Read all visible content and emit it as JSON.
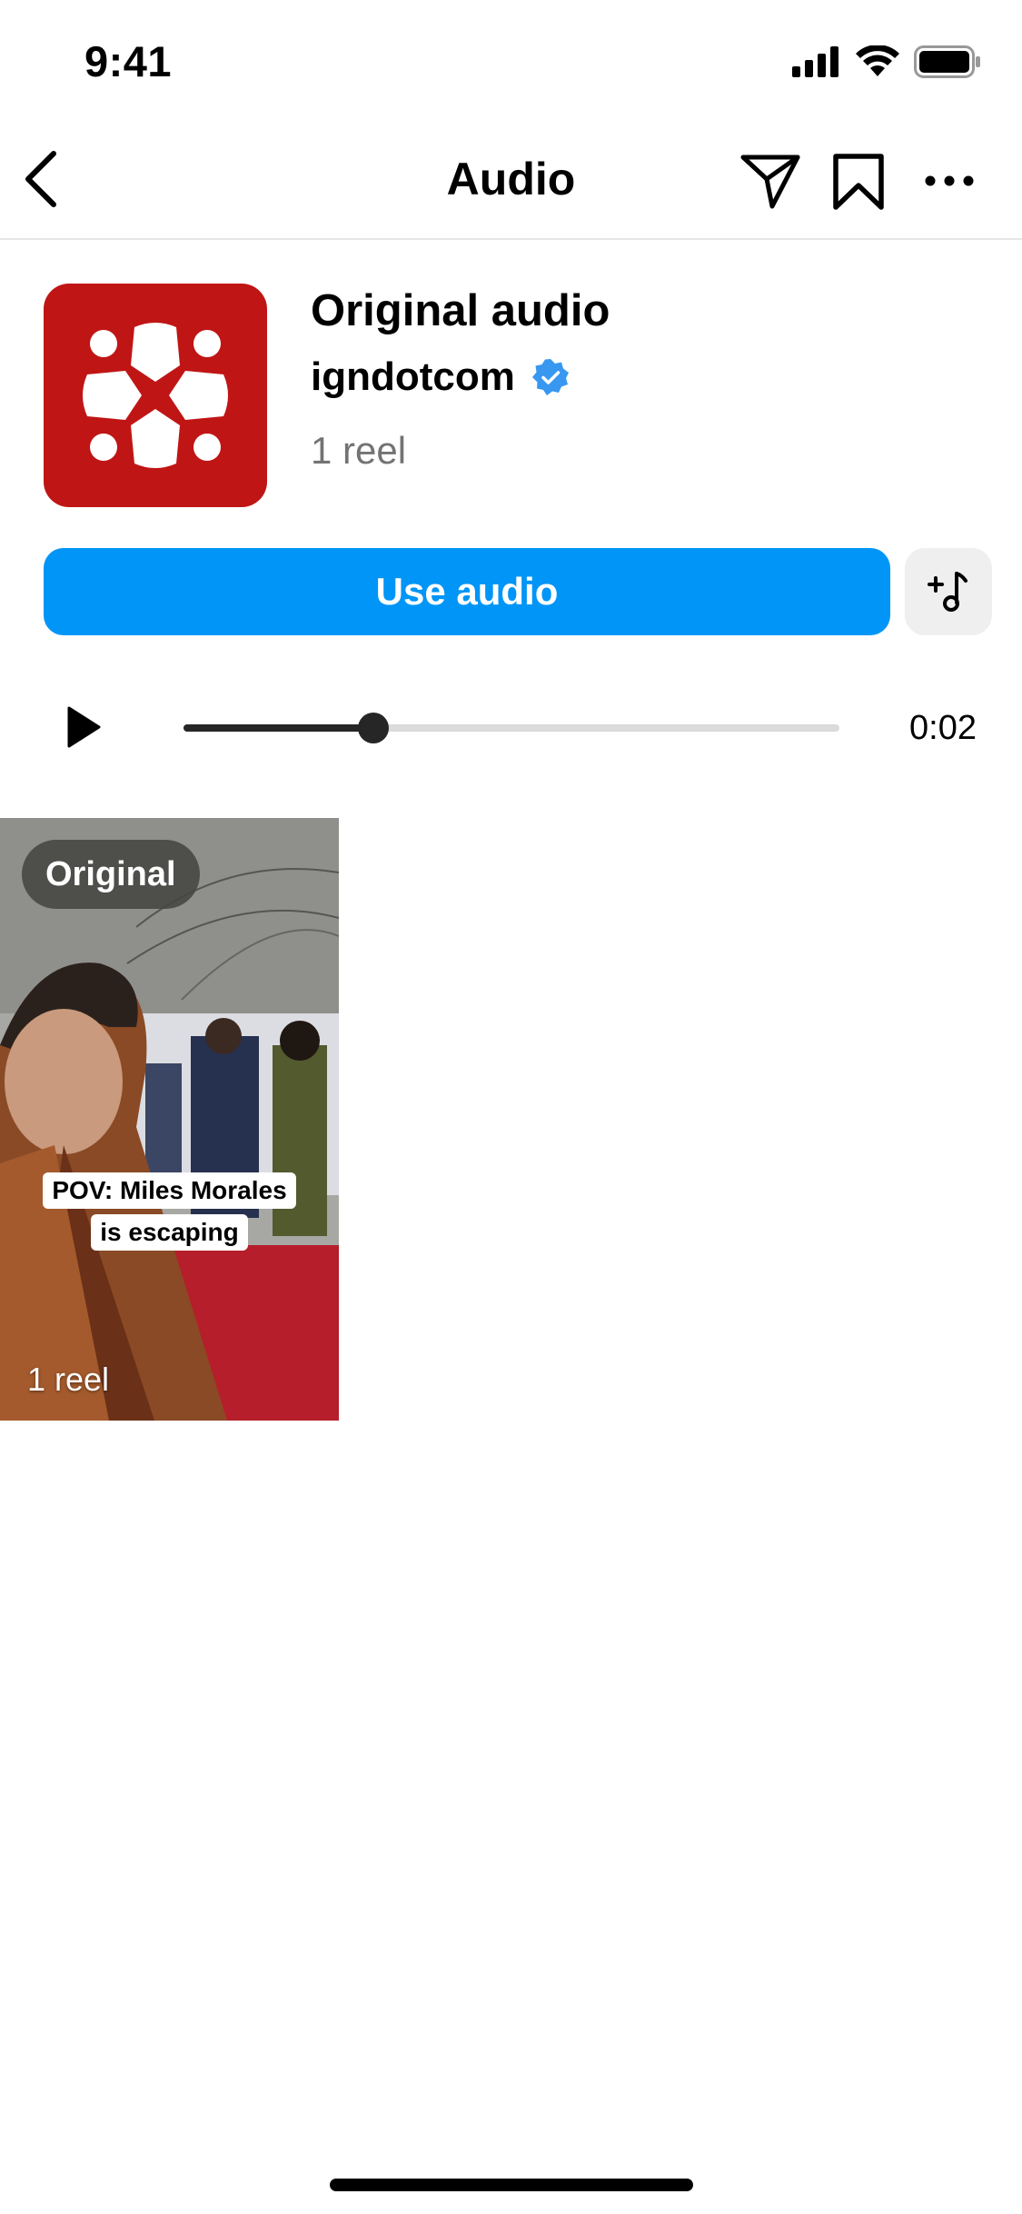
{
  "status_bar": {
    "time": "9:41"
  },
  "nav": {
    "title": "Audio"
  },
  "audio": {
    "title": "Original audio",
    "artist": "igndotcom",
    "reel_count": "1 reel",
    "verified": true,
    "cover_color": "#c01515"
  },
  "actions": {
    "use_audio_label": "Use audio",
    "accent_color": "#0095f6"
  },
  "player": {
    "progress": 0.29,
    "time": "0:02"
  },
  "reels": [
    {
      "badge": "Original",
      "caption_line1": "POV: Miles Morales",
      "caption_line2": "is escaping",
      "count": "1 reel"
    }
  ]
}
